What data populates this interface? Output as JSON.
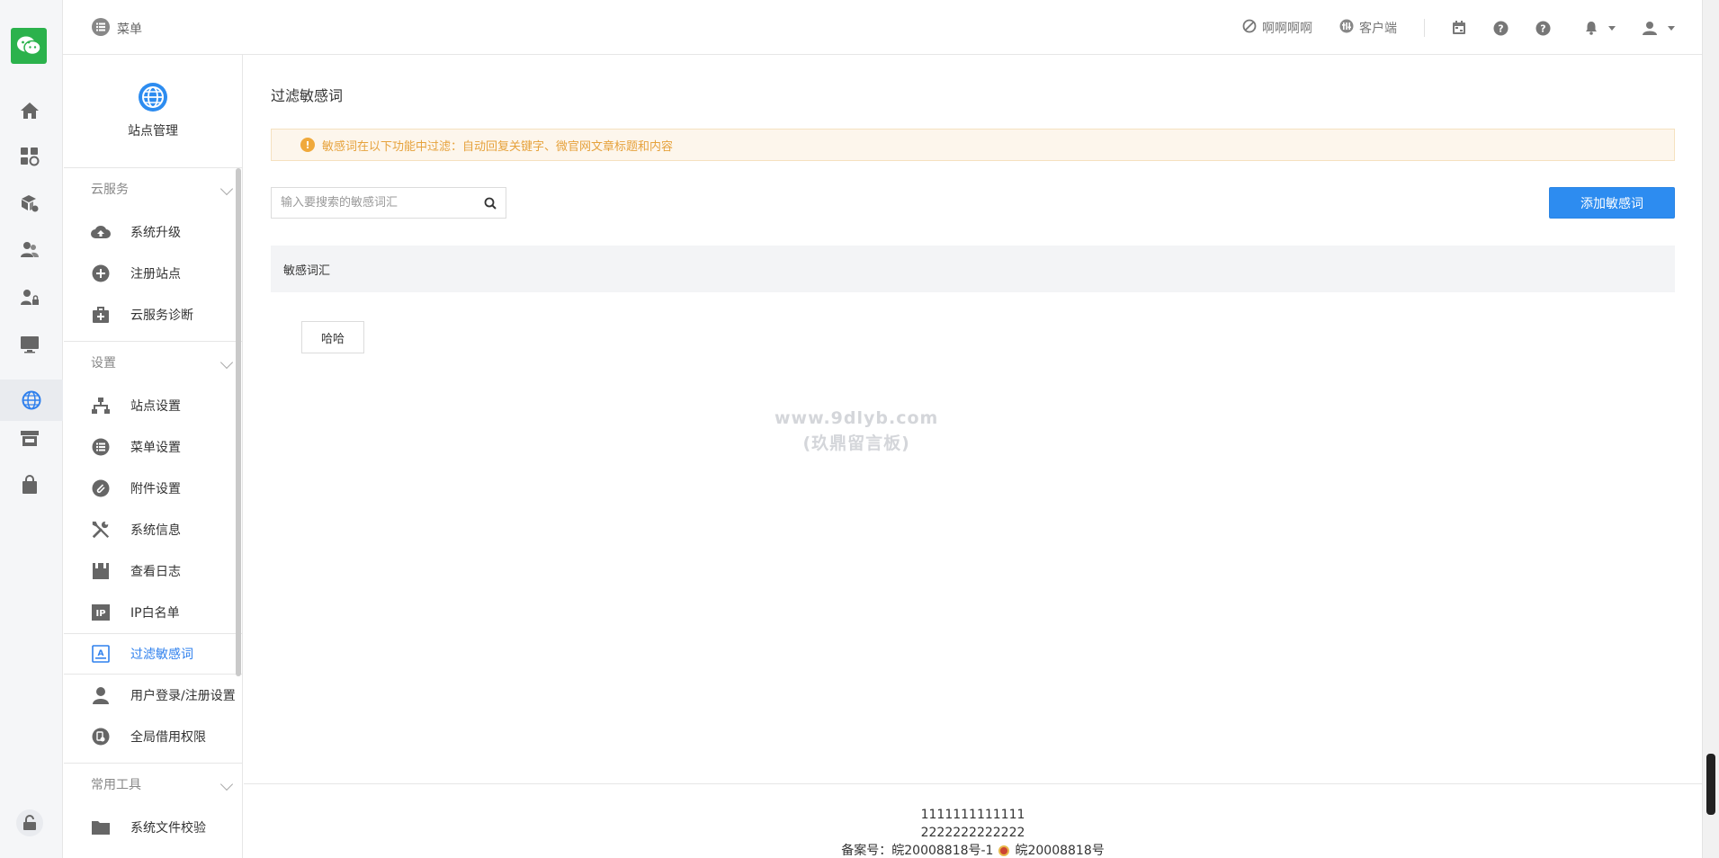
{
  "topbar": {
    "menu_label": "菜单",
    "items": [
      {
        "label": "啊啊啊啊",
        "icon": "ban-icon"
      },
      {
        "label": "客户端",
        "icon": "client-icon"
      }
    ]
  },
  "sidebar": {
    "header_title": "站点管理",
    "groups": [
      {
        "title": "云服务",
        "items": [
          {
            "label": "系统升级",
            "icon": "cloud-upload-icon"
          },
          {
            "label": "注册站点",
            "icon": "plus-circle-icon"
          },
          {
            "label": "云服务诊断",
            "icon": "medkit-icon"
          }
        ]
      },
      {
        "title": "设置",
        "items": [
          {
            "label": "站点设置",
            "icon": "sitemap-icon"
          },
          {
            "label": "菜单设置",
            "icon": "list-icon"
          },
          {
            "label": "附件设置",
            "icon": "paperclip-icon"
          },
          {
            "label": "系统信息",
            "icon": "tools-icon"
          },
          {
            "label": "查看日志",
            "icon": "log-icon"
          },
          {
            "label": "IP白名单",
            "icon": "ip-icon"
          },
          {
            "label": "过滤敏感词",
            "icon": "filter-word-icon"
          },
          {
            "label": "用户登录/注册设置",
            "icon": "user-icon"
          },
          {
            "label": "全局借用权限",
            "icon": "permission-icon"
          }
        ]
      },
      {
        "title": "常用工具",
        "items": [
          {
            "label": "系统文件校验",
            "icon": "folder-icon"
          }
        ]
      }
    ]
  },
  "main": {
    "page_title": "过滤敏感词",
    "alert_text": "敏感词在以下功能中过滤：自动回复关键字、微官网文章标题和内容",
    "search_placeholder": "输入要搜索的敏感词汇",
    "add_button": "添加敏感词",
    "table_header": "敏感词汇",
    "words": [
      "哈哈"
    ],
    "watermark_line1": "www.9dlyb.com",
    "watermark_line2": "(玖鼎留言板)"
  },
  "footer": {
    "line1": "1111111111111",
    "line2": "2222222222222",
    "beian1": "备案号：皖20008818号-1",
    "beian2": "皖20008818号"
  },
  "colors": {
    "accent": "#2d8cf0",
    "warning": "#e6a23c",
    "logo": "#2bb24c"
  }
}
